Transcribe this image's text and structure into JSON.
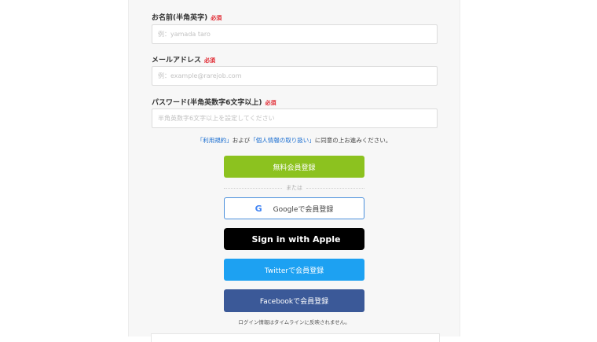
{
  "form": {
    "name": {
      "label": "お名前(半角英字)",
      "required": "必須",
      "placeholder": "例：yamada taro",
      "value": ""
    },
    "email": {
      "label": "メールアドレス",
      "required": "必須",
      "placeholder": "例：example@rarejob.com",
      "value": ""
    },
    "password": {
      "label": "パスワード(半角英数字6文字以上)",
      "required": "必須",
      "placeholder": "半角英数字6文字以上を設定してください",
      "value": ""
    }
  },
  "consent": {
    "terms_link": "「利用規約」",
    "middle": "および",
    "privacy_link": "「個人情報の取り扱い」",
    "suffix": "に同意の上お進みください。"
  },
  "buttons": {
    "register": "無料会員登録",
    "divider": "または",
    "google_icon": "G",
    "google": "Googleで会員登録",
    "apple_icon": "",
    "apple": "Sign in with Apple",
    "twitter": "Twitterで会員登録",
    "facebook": "Facebookで会員登録"
  },
  "note": "ログイン情報はタイムラインに反映されません。",
  "colors": {
    "register": "#8cc21f",
    "google_border": "#4a8fdc",
    "apple": "#000000",
    "twitter": "#1da1f2",
    "facebook": "#3b5998",
    "required": "#e0232c",
    "link": "#1c6fd1"
  }
}
